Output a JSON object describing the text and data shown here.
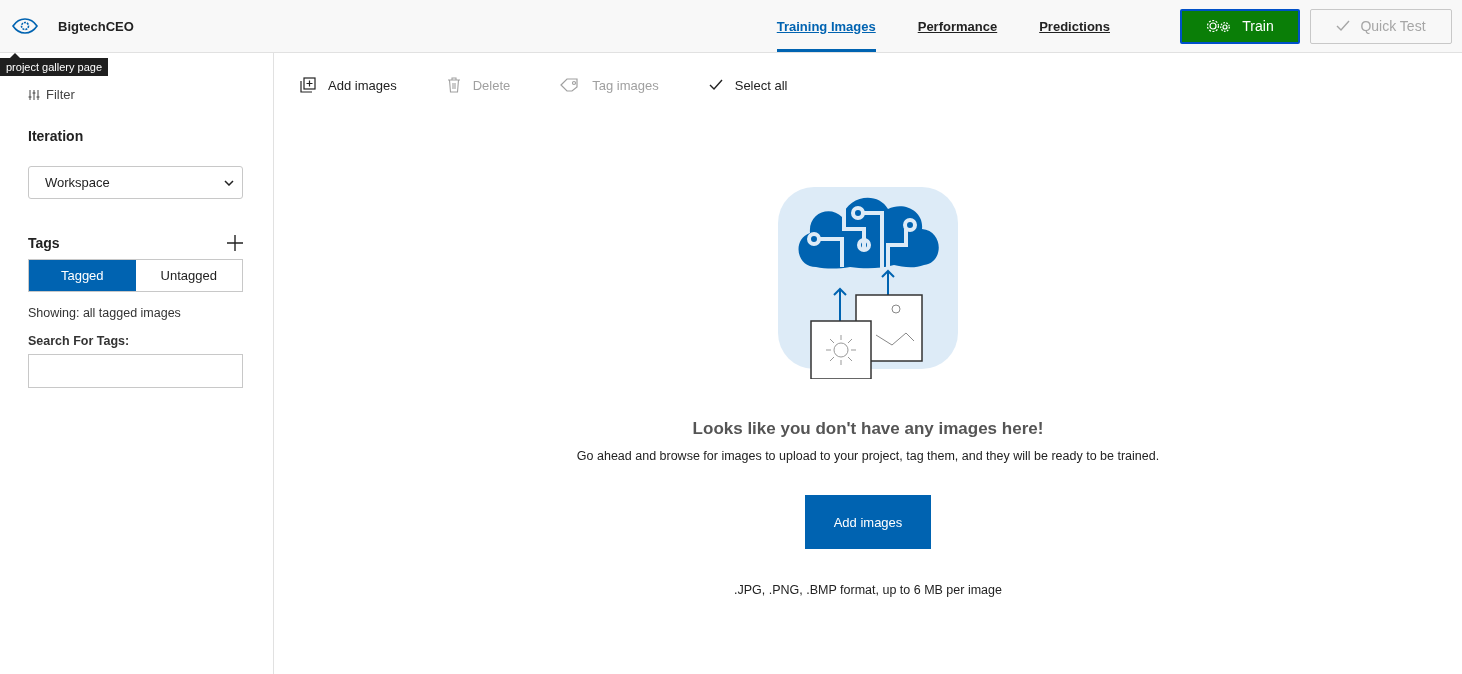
{
  "header": {
    "project_name": "BigtechCEO",
    "tooltip": "project gallery page",
    "nav": [
      {
        "label": "Training Images",
        "selected": true
      },
      {
        "label": "Performance",
        "selected": false
      },
      {
        "label": "Predictions",
        "selected": false
      }
    ],
    "buttons": [
      {
        "kind": "train",
        "label": "Train",
        "disabled": false
      },
      {
        "kind": "quick-test",
        "label": "Quick Test",
        "disabled": true
      }
    ]
  },
  "sidebar": {
    "filter": "Filter",
    "iteration_label": "Iteration",
    "iteration_value": "Workspace",
    "tags_label": "Tags",
    "tag_toggle": [
      {
        "label": "Tagged",
        "selected": true
      },
      {
        "label": "Untagged",
        "selected": false
      }
    ],
    "showing": "Showing: all tagged images",
    "search_label": "Search For Tags:"
  },
  "toolbar": [
    {
      "kind": "add",
      "label": "Add images",
      "disabled": false
    },
    {
      "kind": "delete",
      "label": "Delete",
      "disabled": true
    },
    {
      "kind": "tag",
      "label": "Tag images",
      "disabled": true
    },
    {
      "kind": "select",
      "label": "Select all",
      "disabled": false
    }
  ],
  "empty_state": {
    "title": "Looks like you don't have any images here!",
    "message": "Go ahead and browse for images to upload to your project, tag them, and they will be ready to be trained.",
    "button": "Add images",
    "formats": ".JPG, .PNG, .BMP format, up to 6 MB per image"
  }
}
